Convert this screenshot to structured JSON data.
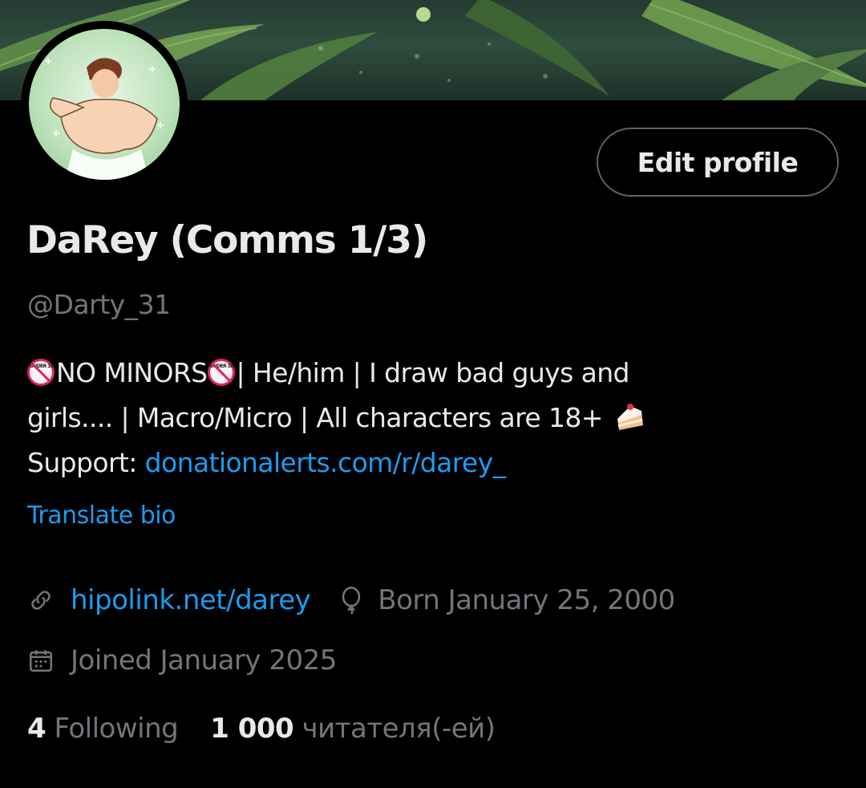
{
  "profile": {
    "display_name": "DaRey (Comms 1/3)",
    "handle": "@Darty_31",
    "edit_button_label": "Edit profile"
  },
  "bio": {
    "badge_text": "UNDER 18",
    "line1_part1": "NO MINORS",
    "line1_part2": "| He/him | I draw bad guys and",
    "line2": "girls.... | Macro/Micro | All characters are 18+",
    "line3_prefix": "Support: ",
    "line3_link": "donationalerts.com/r/darey_",
    "emoji_icons": [
      "no-under-18-icon",
      "cake-slice-icon"
    ]
  },
  "translate_label": "Translate bio",
  "meta": {
    "website": "hipolink.net/darey",
    "birthday": "Born January 25, 2000",
    "joined": "Joined January 2025",
    "icons": [
      "link-icon",
      "balloon-icon",
      "calendar-icon"
    ]
  },
  "stats": {
    "following_count": "4",
    "following_label": "Following",
    "followers_count": "1 000",
    "followers_label": "читателя(-ей)"
  },
  "colors": {
    "background": "#000000",
    "text": "#e7e9ea",
    "muted": "#71767b",
    "accent": "#1d9bf0",
    "button_border": "#536471"
  }
}
